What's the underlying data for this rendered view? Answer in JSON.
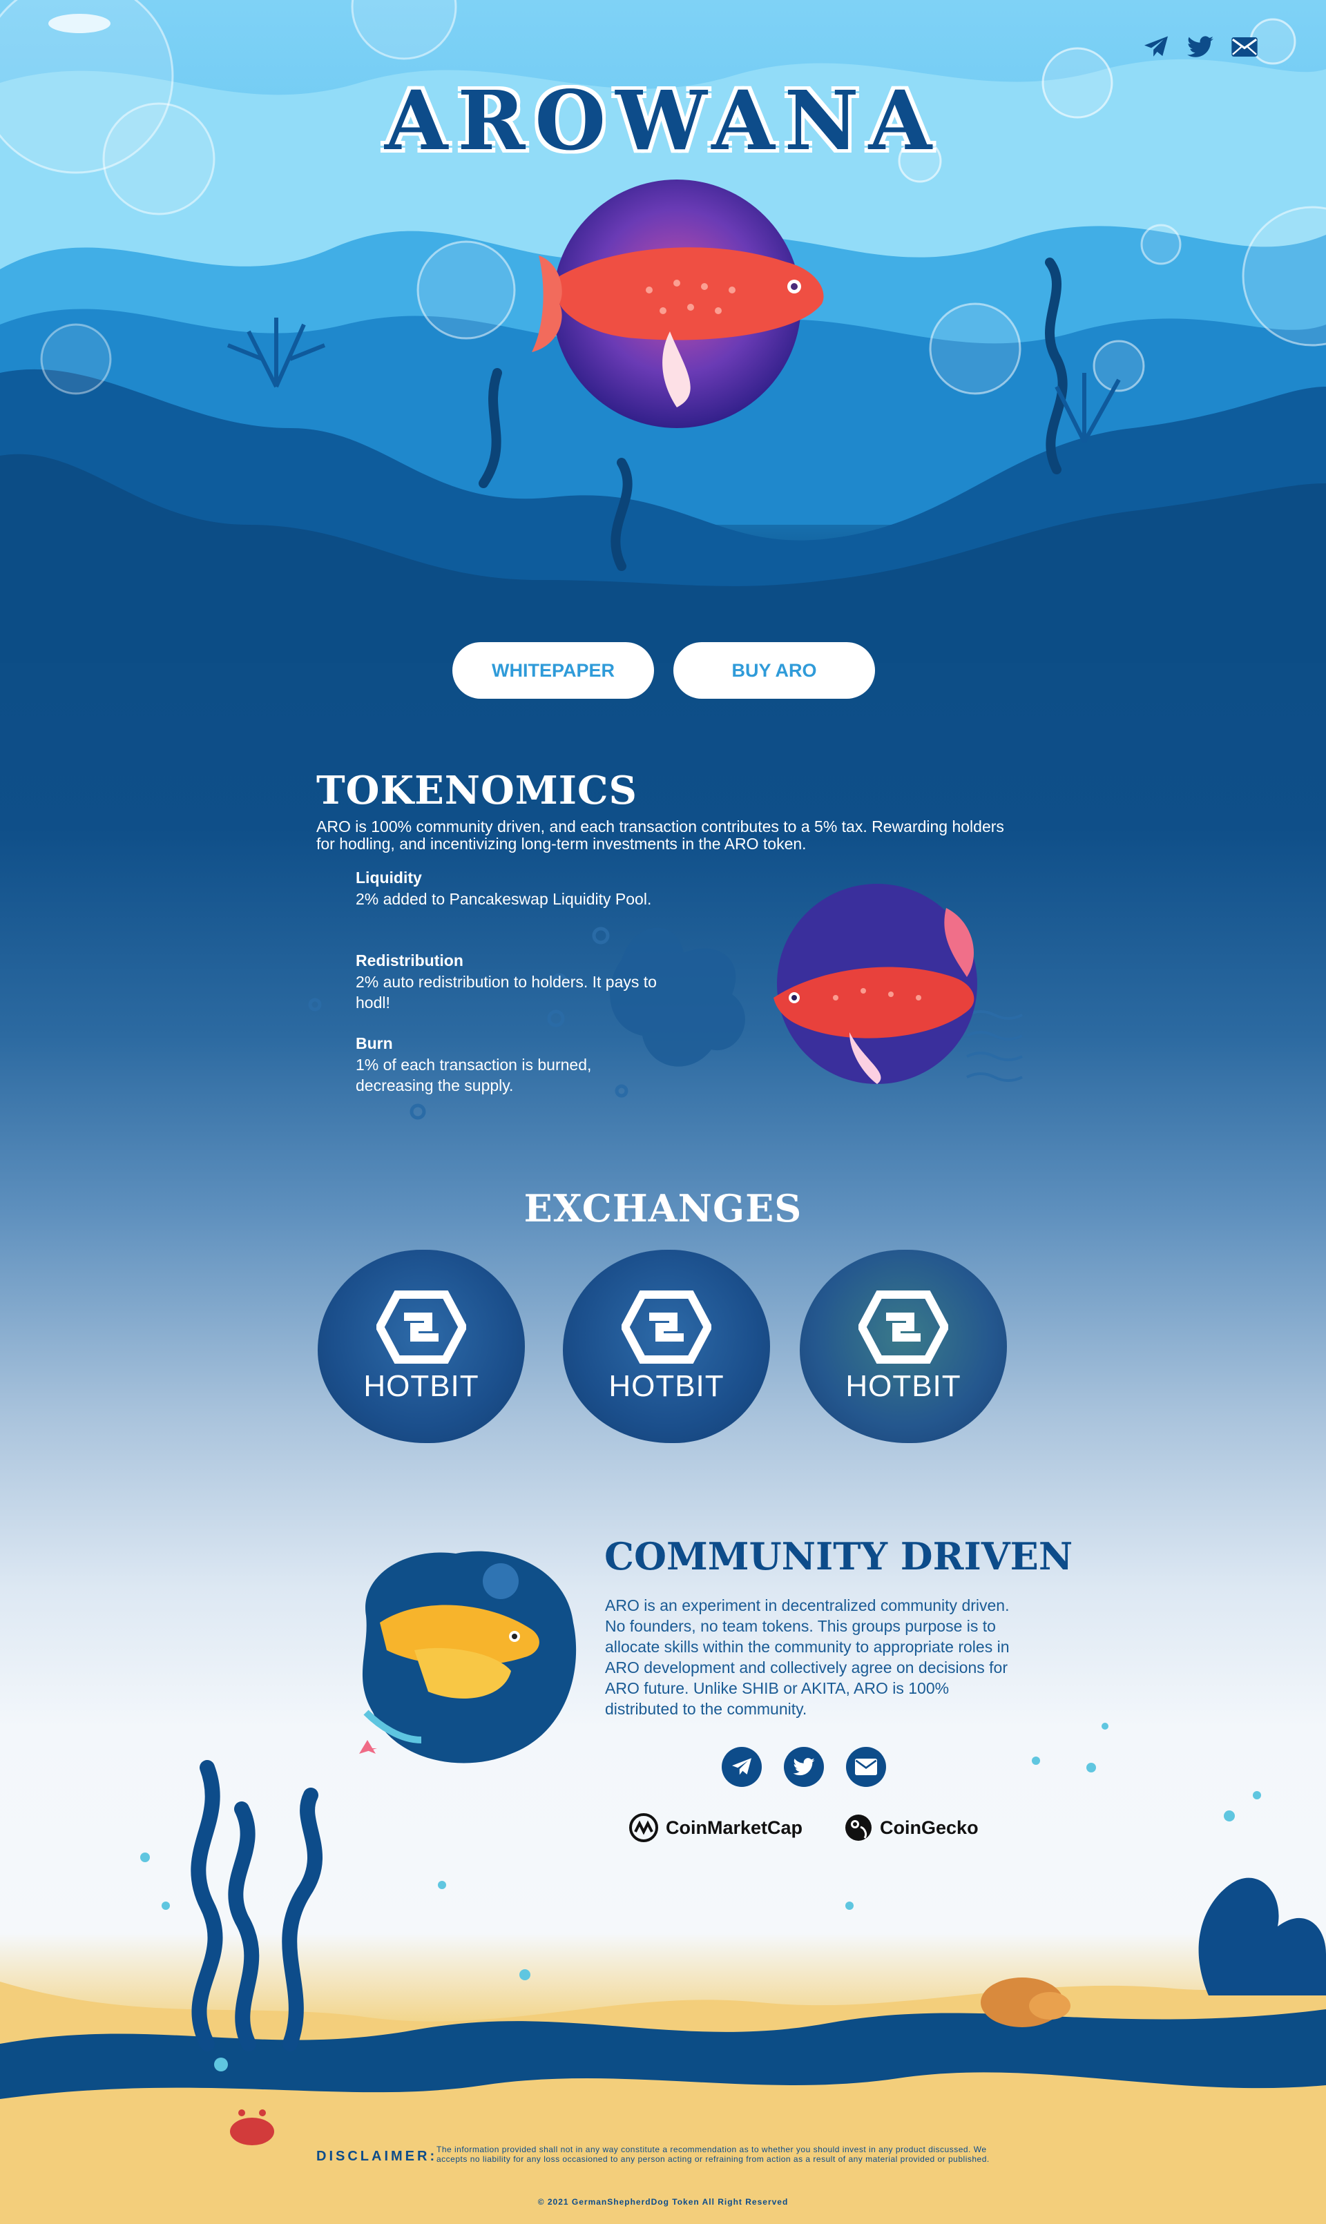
{
  "header": {
    "title": "AROWANA",
    "social": [
      "telegram-icon",
      "twitter-icon",
      "mail-icon"
    ]
  },
  "buttons": {
    "whitepaper": "WHITEPAPER",
    "buy": "BUY ARO"
  },
  "tokenomics": {
    "title": "TOKENOMICS",
    "intro": "ARO is 100% community driven, and each transaction contributes to a 5% tax. Rewarding holders for hodling, and incentivizing long-term investments in the ARO token.",
    "items": [
      {
        "heading": "Liquidity",
        "text": "2% added to Pancakeswap Liquidity Pool."
      },
      {
        "heading": "Redistribution",
        "text": "2% auto redistribution to holders. It pays to hodl!"
      },
      {
        "heading": "Burn",
        "text": "1% of each transaction is burned, decreasing the supply."
      }
    ]
  },
  "exchanges": {
    "title": "EXCHANGES",
    "items": [
      "HOTBIT",
      "HOTBIT",
      "HOTBIT"
    ]
  },
  "community": {
    "title": "COMMUNITY DRIVEN",
    "text": "ARO is an experiment in decentralized community driven. No founders, no team tokens. This groups purpose is to allocate skills within the community to appropriate roles in ARO development and collectively agree on decisions for ARO future. Unlike SHIB or AKITA, ARO is 100% distributed to the community.",
    "brands": [
      "CoinMarketCap",
      "CoinGecko"
    ]
  },
  "footer": {
    "disclaimer_label": "DISCLAIMER:",
    "disclaimer_text": "The information provided shall not in any way constitute a recommendation as to whether you should invest in any product discussed. We accepts no liability for any loss occasioned to any person acting or refraining from action as a result of any material provided or published.",
    "copyright": "© 2021 GermanShepherdDog Token All Right Reserved"
  },
  "colors": {
    "navy": "#0d4c8a",
    "sky": "#7fd2f6",
    "button_text": "#2f9bd9",
    "sand": "#f5d27e"
  }
}
